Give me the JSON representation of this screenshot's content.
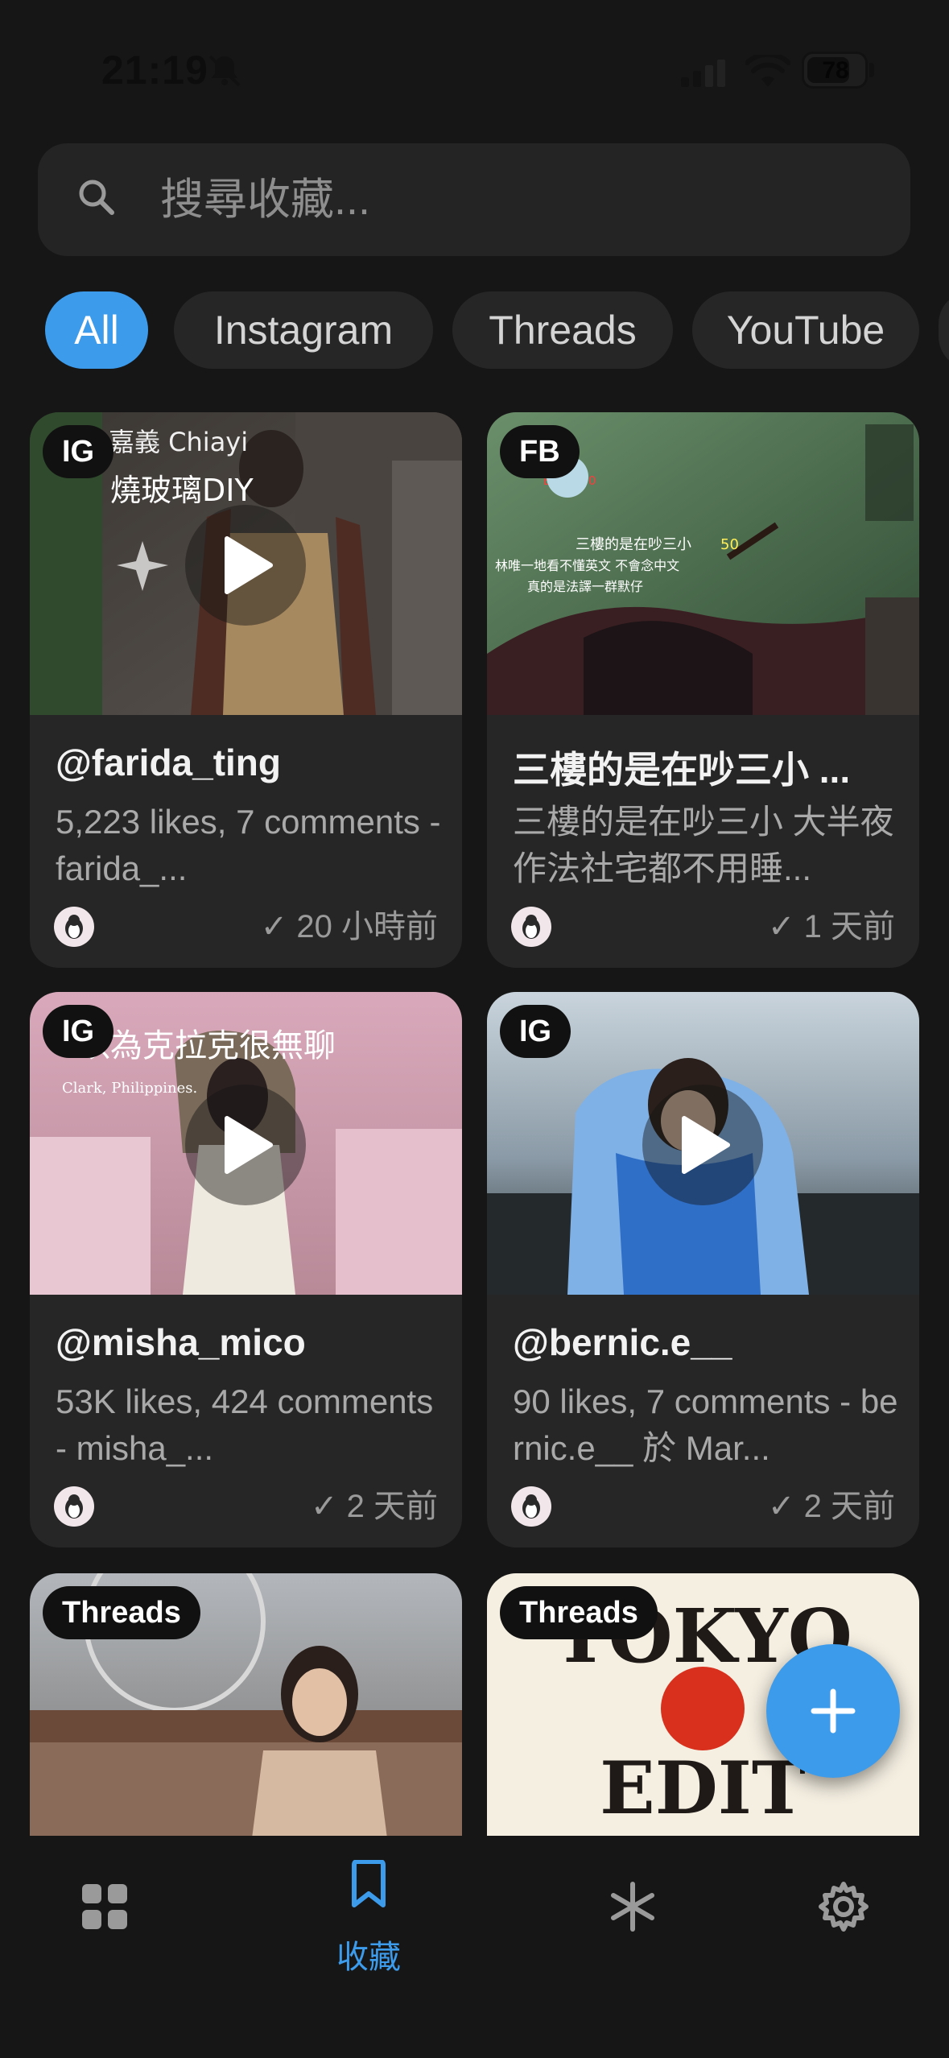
{
  "status_bar": {
    "time": "21:19",
    "battery": "78"
  },
  "search": {
    "placeholder": "搜尋收藏..."
  },
  "filters": [
    {
      "label": "All",
      "active": true
    },
    {
      "label": "Instagram",
      "active": false
    },
    {
      "label": "Threads",
      "active": false
    },
    {
      "label": "YouTube",
      "active": false
    }
  ],
  "cards": [
    {
      "platform": "IG",
      "thumb_text": [
        "嘉義 Chiayi",
        "燒玻璃DIY"
      ],
      "title": "@farida_ting",
      "description": "5,223 likes, 7 comments - farida_...",
      "time": "✓ 20 小時前",
      "has_play": true
    },
    {
      "platform": "FB",
      "thumb_text": [
        "三樓的是在吵三小",
        "50",
        "林唯一地看不懂英文 不會念中文",
        "真的是法譯一群默仔"
      ],
      "title": "三樓的是在吵三小 ...",
      "description": "三樓的是在吵三小 大半夜作法社宅都不用睡...",
      "time": "✓ 1 天前",
      "has_play": false
    },
    {
      "platform": "IG",
      "thumb_text": [
        "以為克拉克很無聊",
        "Clark, Philippines."
      ],
      "title": "@misha_mico",
      "description": "53K likes, 424 comments - misha_...",
      "time": "✓ 2 天前",
      "has_play": true
    },
    {
      "platform": "IG",
      "thumb_text": [],
      "title": "@bernic.e__",
      "description": "90 likes, 7 comments - bernic.e__ 於 Mar...",
      "time": "✓ 2 天前",
      "has_play": true
    },
    {
      "platform": "Threads",
      "thumb_text": [],
      "title": "",
      "description": "",
      "time": "",
      "has_play": false
    },
    {
      "platform": "Threads",
      "thumb_text": [
        "TOKYO",
        "EDIT"
      ],
      "title": "",
      "description": "",
      "time": "",
      "has_play": false
    }
  ],
  "bottom_nav": [
    {
      "icon": "grid-icon",
      "label": "",
      "active": false
    },
    {
      "icon": "bookmark-icon",
      "label": "收藏",
      "active": true
    },
    {
      "icon": "snowflake-icon",
      "label": "",
      "active": false
    },
    {
      "icon": "gear-icon",
      "label": "",
      "active": false
    }
  ],
  "colors": {
    "accent": "#3d9bec",
    "background": "#161616",
    "card": "#262626"
  }
}
